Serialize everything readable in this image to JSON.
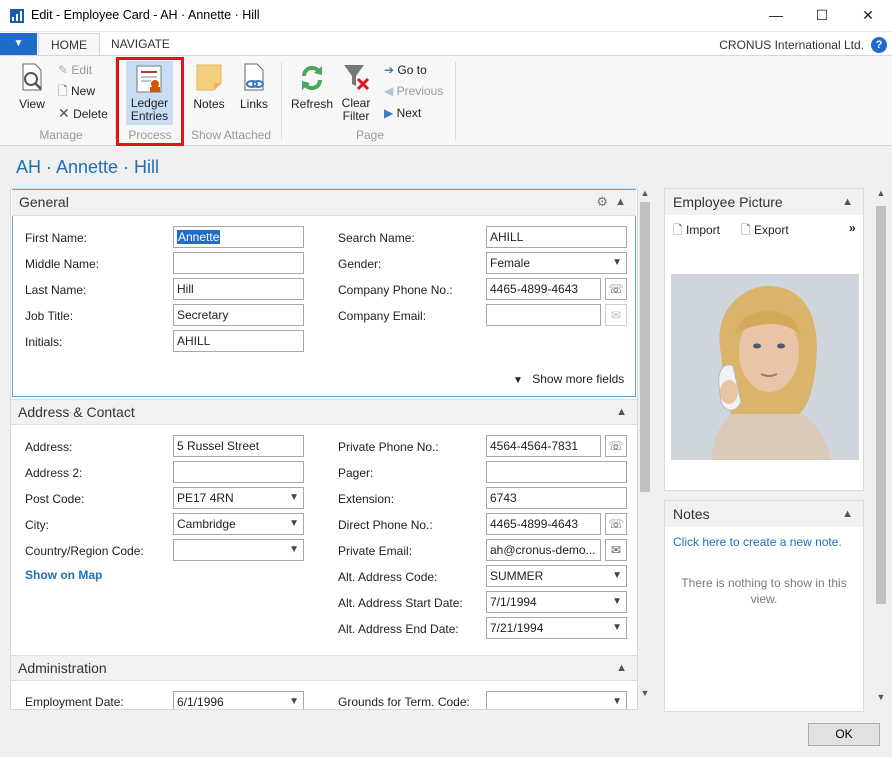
{
  "window": {
    "title": "Edit - Employee Card - AH · Annette · Hill",
    "minimize": "—",
    "maximize": "☐",
    "close": "✕"
  },
  "ribbon": {
    "file_tab": "▼",
    "tabs": [
      "HOME",
      "NAVIGATE"
    ],
    "company": "CRONUS International Ltd.",
    "help": "?",
    "manage": {
      "view": "View",
      "edit": "Edit",
      "new": "New",
      "delete": "Delete",
      "label": "Manage"
    },
    "process": {
      "ledger_line1": "Ledger",
      "ledger_line2": "Entries",
      "label": "Process"
    },
    "show_attached": {
      "notes": "Notes",
      "links": "Links",
      "label": "Show Attached"
    },
    "page": {
      "refresh": "Refresh",
      "clear_line1": "Clear",
      "clear_line2": "Filter",
      "goto": "Go to",
      "previous": "Previous",
      "next": "Next",
      "label": "Page"
    }
  },
  "page_title": "AH · Annette · Hill",
  "general": {
    "header": "General",
    "first_name_label": "First Name:",
    "first_name": "Annette",
    "middle_name_label": "Middle Name:",
    "middle_name": "",
    "last_name_label": "Last Name:",
    "last_name": "Hill",
    "job_title_label": "Job Title:",
    "job_title": "Secretary",
    "initials_label": "Initials:",
    "initials": "AHILL",
    "search_name_label": "Search Name:",
    "search_name": "AHILL",
    "gender_label": "Gender:",
    "gender": "Female",
    "company_phone_label": "Company Phone No.:",
    "company_phone": "4465-4899-4643",
    "company_email_label": "Company Email:",
    "company_email": "",
    "show_more": "Show more fields"
  },
  "address": {
    "header": "Address & Contact",
    "address_label": "Address:",
    "address": "5 Russel Street",
    "address2_label": "Address 2:",
    "address2": "",
    "post_code_label": "Post Code:",
    "post_code": "PE17 4RN",
    "city_label": "City:",
    "city": "Cambridge",
    "country_label": "Country/Region Code:",
    "country": "",
    "show_on_map": "Show on Map",
    "private_phone_label": "Private Phone No.:",
    "private_phone": "4564-4564-7831",
    "pager_label": "Pager:",
    "pager": "",
    "extension_label": "Extension:",
    "extension": "6743",
    "direct_phone_label": "Direct Phone No.:",
    "direct_phone": "4465-4899-4643",
    "private_email_label": "Private Email:",
    "private_email": "ah@cronus-demo...",
    "alt_address_code_label": "Alt. Address Code:",
    "alt_address_code": "SUMMER",
    "alt_start_label": "Alt. Address Start Date:",
    "alt_start": "7/1/1994",
    "alt_end_label": "Alt. Address End Date:",
    "alt_end": "7/21/1994"
  },
  "administration": {
    "header": "Administration",
    "employment_date_label": "Employment Date:",
    "employment_date": "6/1/1996",
    "grounds_label": "Grounds for Term. Code:",
    "grounds": ""
  },
  "factbox_picture": {
    "title": "Employee Picture",
    "import": "Import",
    "export": "Export",
    "more": "»"
  },
  "factbox_notes": {
    "title": "Notes",
    "create_link": "Click here to create a new note.",
    "empty_line1": "There is nothing to show in this",
    "empty_line2": "view."
  },
  "ok": "OK",
  "colors": {
    "accent": "#1e6bc9",
    "title_blue": "#1f6fb5",
    "highlight_red": "#e1141e"
  }
}
